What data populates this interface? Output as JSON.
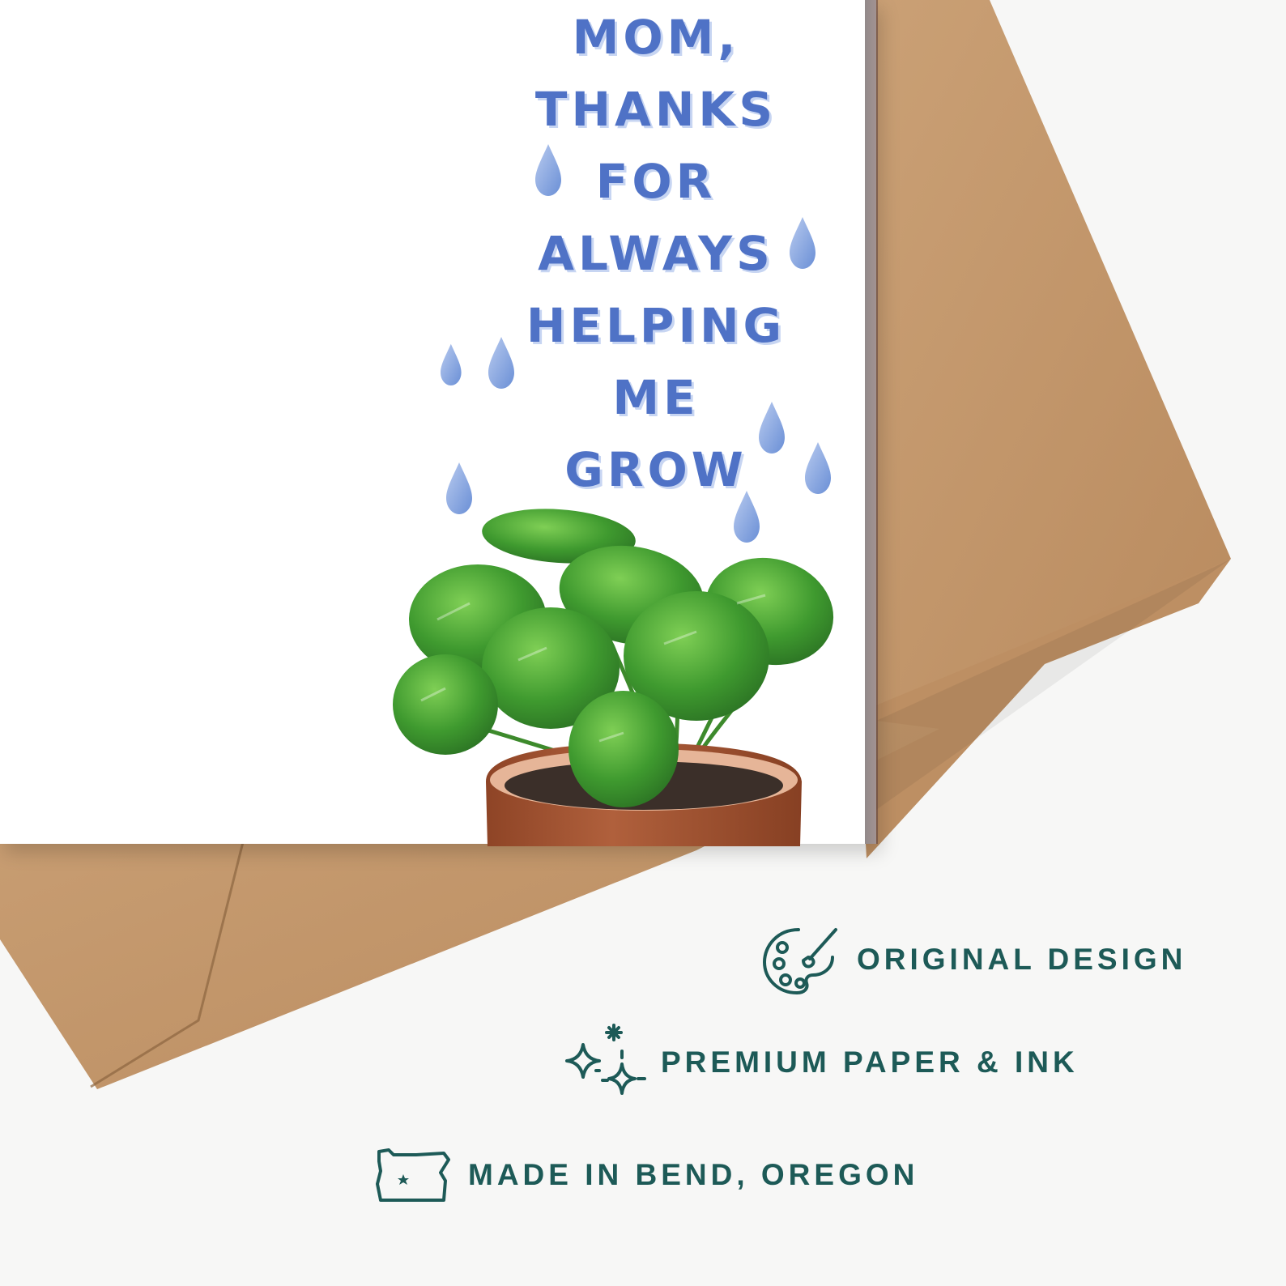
{
  "card": {
    "lines": [
      "MOM,",
      "THANKS",
      "FOR",
      "ALWAYS",
      "HELPING",
      "ME",
      "GROW"
    ]
  },
  "features": [
    {
      "icon": "palette-icon",
      "label": "ORIGINAL DESIGN"
    },
    {
      "icon": "sparkles-icon",
      "label": "PREMIUM PAPER & INK"
    },
    {
      "icon": "oregon-map-icon",
      "label": "MADE IN BEND, OREGON"
    }
  ],
  "colors": {
    "background": "#f7f7f6",
    "card": "#ffffff",
    "lettering": "#4f72c6",
    "kraft_envelope": "#c39468",
    "feature_text": "#1d5a57",
    "leaf": "#3f9a2f",
    "pot": "#b0603c"
  }
}
